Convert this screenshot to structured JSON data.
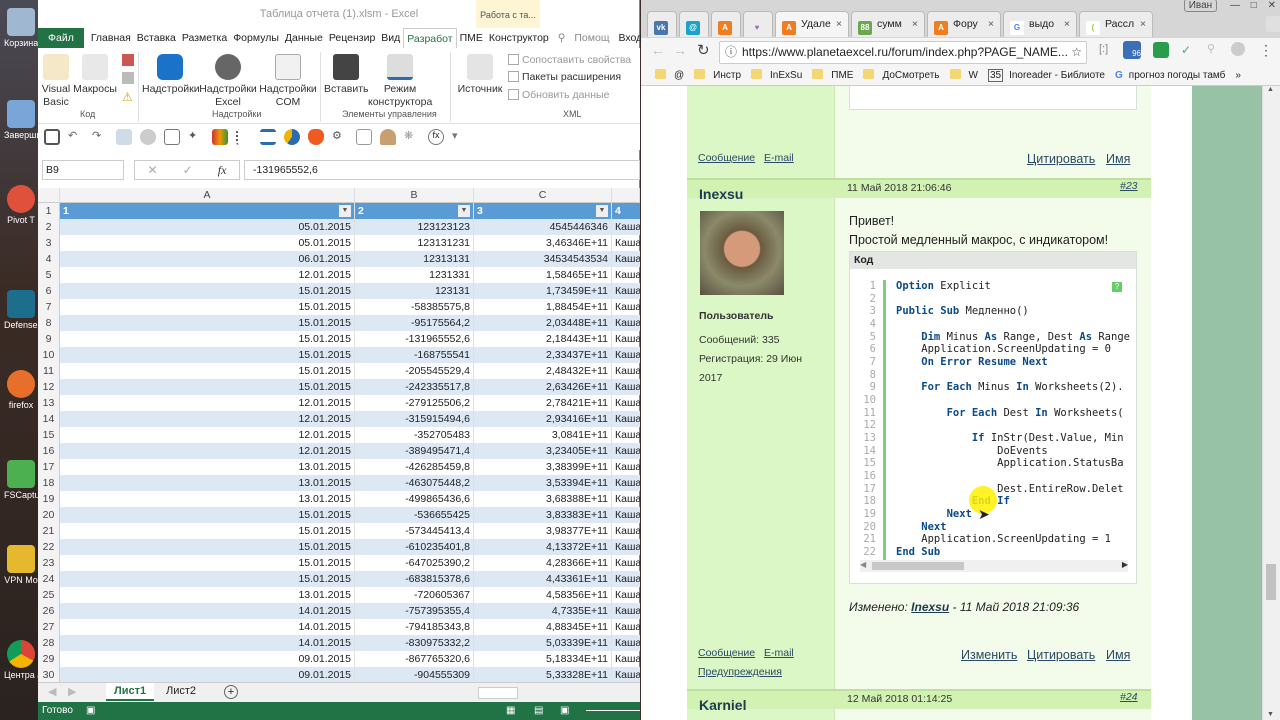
{
  "desktop": {
    "icons": [
      "Корзина",
      "Заверши",
      "Pivot T",
      "Defense - Ярл",
      "firefox",
      "FSCaptu - Ярл",
      "VPN Mo",
      "Центра аппарат"
    ]
  },
  "excel": {
    "title": "Таблица отчета (1).xlsm - Excel",
    "context_tab": "Работа с та...",
    "tabs": [
      "Файл",
      "Главная",
      "Вставка",
      "Разметка",
      "Формулы",
      "Данные",
      "Рецензир",
      "Вид",
      "Разработ",
      "ПМЕ",
      "Конструктор",
      "Помощ",
      "Вход"
    ],
    "active_tab": "Разработ",
    "ribbon": {
      "visual_basic": "Visual Basic",
      "macros": "Макросы",
      "group_code": "Код",
      "addins": "Надстройки",
      "excel_addins": "Надстройки Excel",
      "com_addins": "Надстройки COM",
      "group_addins": "Надстройки",
      "insert": "Вставить",
      "design_mode": "Режим конструктора",
      "group_controls": "Элементы управления",
      "source": "Источник",
      "map_props": "Сопоставить свойства",
      "expansion_packs": "Пакеты расширения",
      "refresh_data": "Обновить данные",
      "group_xml": "XML"
    },
    "name_box": "B9",
    "formula": "-131965552,6",
    "columns": [
      "A",
      "B",
      "C"
    ],
    "header_row": [
      "1",
      "2",
      "3",
      "4"
    ],
    "rows": [
      [
        "05.01.2015",
        "123123123",
        "4545446346",
        "Каша"
      ],
      [
        "05.01.2015",
        "123131231",
        "3,46346E+11",
        "Каша"
      ],
      [
        "06.01.2015",
        "12313131",
        "34534543534",
        "Каша"
      ],
      [
        "12.01.2015",
        "1231331",
        "1,58465E+11",
        "Каша"
      ],
      [
        "15.01.2015",
        "123131",
        "1,73459E+11",
        "Каша"
      ],
      [
        "15.01.2015",
        "-58385575,8",
        "1,88454E+11",
        "Каша"
      ],
      [
        "15.01.2015",
        "-95175564,2",
        "2,03448E+11",
        "Каша"
      ],
      [
        "15.01.2015",
        "-131965552,6",
        "2,18443E+11",
        "Каша"
      ],
      [
        "15.01.2015",
        "-168755541",
        "2,33437E+11",
        "Каша"
      ],
      [
        "15.01.2015",
        "-205545529,4",
        "2,48432E+11",
        "Каша"
      ],
      [
        "15.01.2015",
        "-242335517,8",
        "2,63426E+11",
        "Каша"
      ],
      [
        "12.01.2015",
        "-279125506,2",
        "2,78421E+11",
        "Каша"
      ],
      [
        "12.01.2015",
        "-315915494,6",
        "2,93416E+11",
        "Каша"
      ],
      [
        "12.01.2015",
        "-352705483",
        "3,0841E+11",
        "Каша"
      ],
      [
        "12.01.2015",
        "-389495471,4",
        "3,23405E+11",
        "Каша"
      ],
      [
        "13.01.2015",
        "-426285459,8",
        "3,38399E+11",
        "Каша"
      ],
      [
        "13.01.2015",
        "-463075448,2",
        "3,53394E+11",
        "Каша"
      ],
      [
        "13.01.2015",
        "-499865436,6",
        "3,68388E+11",
        "Каша"
      ],
      [
        "15.01.2015",
        "-536655425",
        "3,83383E+11",
        "Каша"
      ],
      [
        "15.01.2015",
        "-573445413,4",
        "3,98377E+11",
        "Каша"
      ],
      [
        "15.01.2015",
        "-610235401,8",
        "4,13372E+11",
        "Каша"
      ],
      [
        "15.01.2015",
        "-647025390,2",
        "4,28366E+11",
        "Каша"
      ],
      [
        "15.01.2015",
        "-683815378,6",
        "4,43361E+11",
        "Каша"
      ],
      [
        "13.01.2015",
        "-720605367",
        "4,58356E+11",
        "Каша"
      ],
      [
        "14.01.2015",
        "-757395355,4",
        "4,7335E+11",
        "Каша"
      ],
      [
        "14.01.2015",
        "-794185343,8",
        "4,88345E+11",
        "Каша"
      ],
      [
        "14.01.2015",
        "-830975332,2",
        "5,03339E+11",
        "Каша"
      ],
      [
        "09.01.2015",
        "-867765320,6",
        "5,18334E+11",
        "Каша"
      ],
      [
        "09.01.2015",
        "-904555309",
        "5,33328E+11",
        "Каша"
      ]
    ],
    "sheets": [
      "Лист1",
      "Лист2"
    ],
    "active_sheet": "Лист1",
    "status": "Готово"
  },
  "browser": {
    "profile": "Иван",
    "tabs": [
      {
        "icon": "vk",
        "label": ""
      },
      {
        "icon": "mail",
        "label": ""
      },
      {
        "icon": "planetaexcel",
        "label": ""
      },
      {
        "icon": "heart",
        "label": ""
      },
      {
        "icon": "planetaexcel",
        "label": "Удале"
      },
      {
        "icon": "88",
        "label": "сумм"
      },
      {
        "icon": "planetaexcel",
        "label": "Фору"
      },
      {
        "icon": "google",
        "label": "выдо"
      },
      {
        "icon": "leaf",
        "label": "Рассл"
      }
    ],
    "url": "https://www.planetaexcel.ru/forum/index.php?PAGE_NAME...",
    "bookmarks": [
      "@",
      "Инстр",
      "InExSu",
      "ПМЕ",
      "ДоСмотреть",
      "W",
      "Inoreader - Библиоте",
      "прогноз погоды тамб",
      "»"
    ],
    "badge_96": "96",
    "bookmark_35": "35"
  },
  "forum": {
    "prev_links": {
      "message": "Сообщение",
      "email": "E-mail",
      "quote": "Цитировать",
      "name": "Имя"
    },
    "post": {
      "author": "Inexsu",
      "date": "11 Май 2018 21:06:46",
      "number": "#23",
      "role": "Пользователь",
      "messages": "Сообщений: 335",
      "registered": "Регистрация: 29 Июн 2017",
      "greeting": "Привет!",
      "text": "Простой медленный макрос, с индикатором!",
      "code_label": "Код",
      "code": [
        [
          [
            "Option",
            "k"
          ],
          [
            " Explicit",
            ""
          ]
        ],
        [],
        [
          [
            "Public Sub",
            "k"
          ],
          [
            " Медленно()",
            ""
          ]
        ],
        [],
        [
          [
            "    Dim",
            "k"
          ],
          [
            " Minus ",
            ""
          ],
          [
            "As",
            "k"
          ],
          [
            " Range, Dest ",
            ""
          ],
          [
            "As",
            "k"
          ],
          [
            " Range",
            ""
          ]
        ],
        [
          [
            "    Application.ScreenUpdating = 0",
            ""
          ]
        ],
        [
          [
            "    On Error Resume Next",
            "k"
          ]
        ],
        [],
        [
          [
            "    For Each",
            "k"
          ],
          [
            " Minus ",
            ""
          ],
          [
            "In",
            "k"
          ],
          [
            " Worksheets(2).",
            ""
          ]
        ],
        [],
        [
          [
            "        For Each",
            "k"
          ],
          [
            " Dest ",
            ""
          ],
          [
            "In",
            "k"
          ],
          [
            " Worksheets(",
            ""
          ]
        ],
        [],
        [
          [
            "            If",
            "k"
          ],
          [
            " InStr(Dest.Value, Min",
            ""
          ]
        ],
        [
          [
            "                DoEvents",
            ""
          ]
        ],
        [
          [
            "                Application.StatusBa",
            ""
          ]
        ],
        [],
        [
          [
            "                Dest.EntireRow.Delet",
            ""
          ]
        ],
        [
          [
            "            End If",
            "k"
          ]
        ],
        [
          [
            "        Next",
            "k"
          ]
        ],
        [
          [
            "    Next",
            "k"
          ]
        ],
        [
          [
            "    Application.ScreenUpdating = 1",
            ""
          ]
        ],
        [
          [
            "End Sub",
            "k"
          ]
        ]
      ],
      "edited_label": "Изменено:",
      "edited_by": "Inexsu",
      "edited_date": "- 11 Май 2018 21:09:36",
      "links": {
        "message": "Сообщение",
        "email": "E-mail",
        "warnings": "Предупреждения",
        "edit": "Изменить",
        "quote": "Цитировать",
        "name": "Имя"
      }
    },
    "next_post": {
      "author": "Karniel",
      "date": "12 Май 2018 01:14:25",
      "number": "#24"
    }
  }
}
